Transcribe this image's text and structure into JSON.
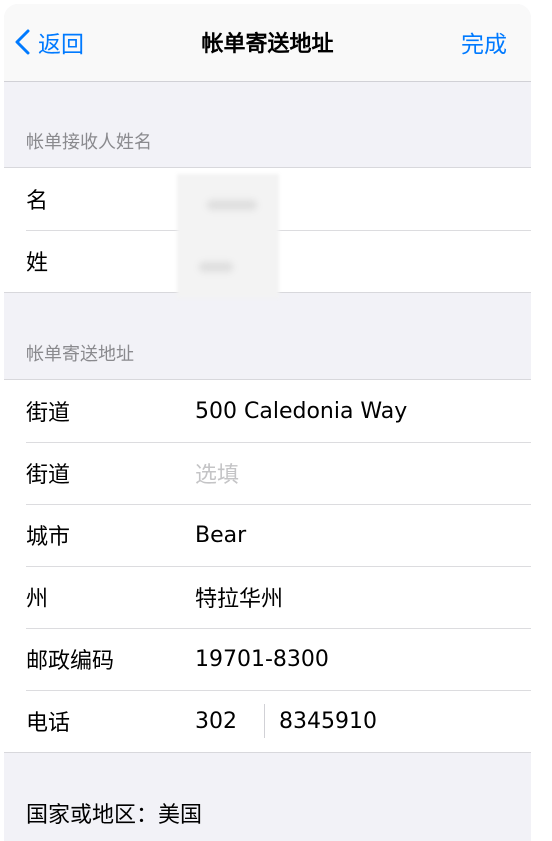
{
  "nav": {
    "back_label": "返回",
    "title": "帐单寄送地址",
    "done_label": "完成"
  },
  "name_section": {
    "header": "帐单接收人姓名",
    "rows": [
      {
        "label": "名",
        "value": ""
      },
      {
        "label": "姓",
        "value": ""
      }
    ]
  },
  "address_section": {
    "header": "帐单寄送地址",
    "street1": {
      "label": "街道",
      "value": "500 Caledonia Way"
    },
    "street2": {
      "label": "街道",
      "placeholder": "选填"
    },
    "city": {
      "label": "城市",
      "value": "Bear"
    },
    "state": {
      "label": "州",
      "value": "特拉华州"
    },
    "postal": {
      "label": "邮政编码",
      "value": "19701-8300"
    },
    "phone": {
      "label": "电话",
      "area_code": "302",
      "number": "8345910"
    }
  },
  "country": "国家或地区：美国",
  "colors": {
    "accent": "#007aff",
    "background": "#f2f2f7",
    "secondary_text": "#8a8a8e"
  }
}
